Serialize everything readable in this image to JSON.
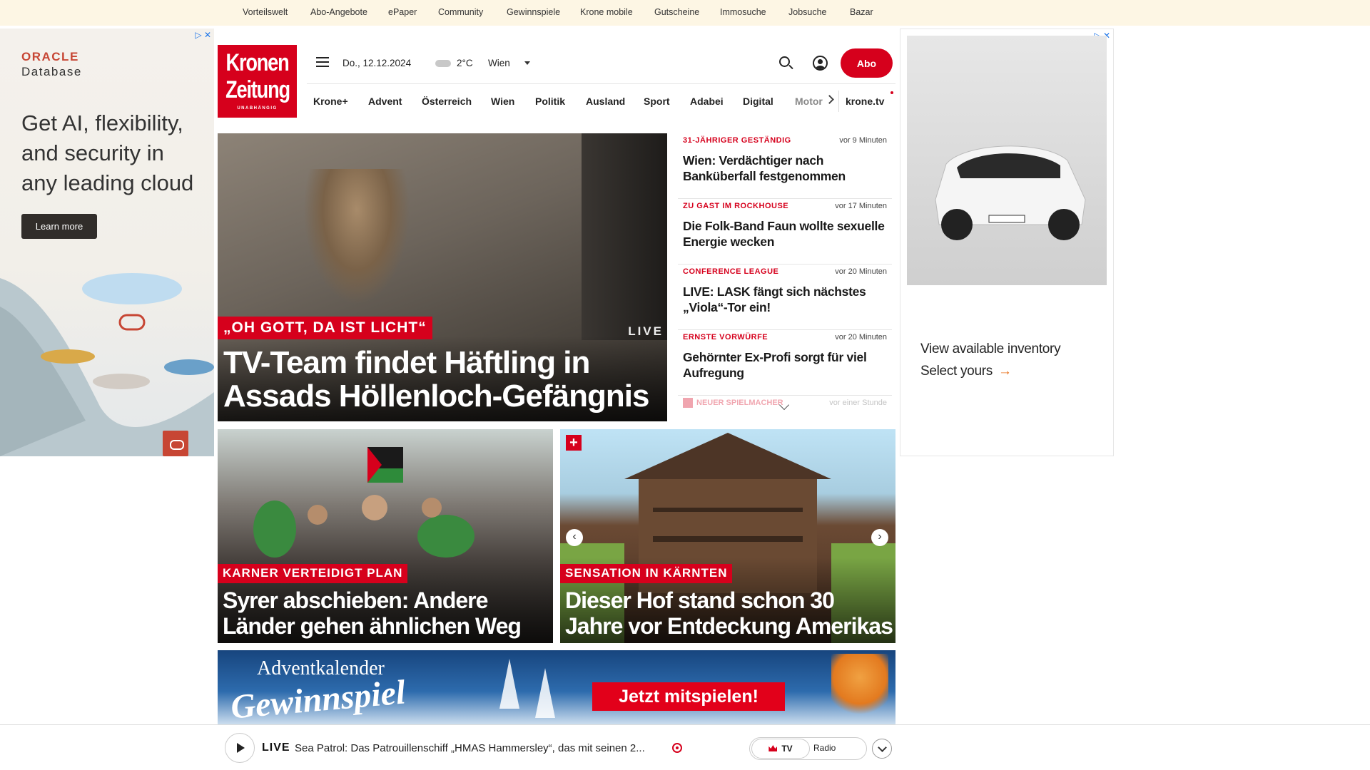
{
  "topbar": {
    "links": [
      "Vorteilswelt",
      "Abo-Angebote",
      "ePaper",
      "Community",
      "Gewinnspiele",
      "Krone mobile",
      "Gutscheine",
      "Immosuche",
      "Jobsuche",
      "Bazar"
    ]
  },
  "ad_left": {
    "brand_line1": "ORACLE",
    "brand_line2": "Database",
    "headline": "Get AI, flexibility, and security in any leading cloud",
    "button": "Learn more",
    "adchoice": "▷ ✕"
  },
  "ad_right": {
    "adchoice": "▷ ✕",
    "line1": "View available inventory",
    "line2": "Select yours",
    "arrow": "→"
  },
  "logo": {
    "line1": "Kronen",
    "line2": "Zeitung",
    "line3": "UNABHÄNGIG"
  },
  "header": {
    "date": "Do., 12.12.2024",
    "temperature": "2°C",
    "city": "Wien",
    "abo_label": "Abo"
  },
  "nav": {
    "items": [
      "Krone+",
      "Advent",
      "Österreich",
      "Wien",
      "Politik",
      "Ausland",
      "Sport",
      "Adabei",
      "Digital",
      "Motor"
    ],
    "extra": "krone.tv"
  },
  "hero": {
    "kicker": "„OH GOTT, DA IST LICHT“",
    "title": "TV-Team findet Häftling in Assads Höllenloch-Gefängnis",
    "live_tag": "LIVE"
  },
  "ticker": {
    "items": [
      {
        "kicker": "31-JÄHRIGER GESTÄNDIG",
        "time": "vor 9 Minuten",
        "headline": "Wien: Verdächtiger nach Banküberfall festgenommen"
      },
      {
        "kicker": "ZU GAST IM ROCKHOUSE",
        "time": "vor 17 Minuten",
        "headline": "Die Folk-Band Faun wollte sexuelle Energie wecken"
      },
      {
        "kicker": "CONFERENCE LEAGUE",
        "time": "vor 20 Minuten",
        "headline": "LIVE: LASK fängt sich nächstes „Viola“-Tor ein!"
      },
      {
        "kicker": "ERNSTE VORWÜRFE",
        "time": "vor 20 Minuten",
        "headline": "Gehörnter Ex-Profi sorgt für viel Aufregung"
      }
    ],
    "faded": {
      "kicker": "NEUER SPIELMACHER",
      "time": "vor einer Stunde"
    }
  },
  "cards": [
    {
      "kicker": "KARNER VERTEIDIGT PLAN",
      "title": "Syrer abschieben: Andere Länder gehen ähnlichen Weg"
    },
    {
      "kicker": "SENSATION IN KÄRNTEN",
      "title": "Dieser Hof stand schon 30 Jahre vor Entdeckung Amerikas",
      "badge": "+",
      "prev": "‹",
      "next": "›"
    }
  ],
  "banner": {
    "line1": "Adventkalender",
    "line2": "Gewinnspiel",
    "cta": "Jetzt mitspielen!"
  },
  "player": {
    "live_label": "LIVE",
    "text": "Sea Patrol: Das Patrouillenschiff „HMAS Hammersley“, das mit seinen 2...",
    "tv_label": "TV",
    "radio_label": "Radio"
  },
  "colors": {
    "brand_red": "#d6001c",
    "topbar_bg": "#fdf6e4",
    "oracle_red": "#c74634",
    "cta_orange": "#e8721c"
  }
}
